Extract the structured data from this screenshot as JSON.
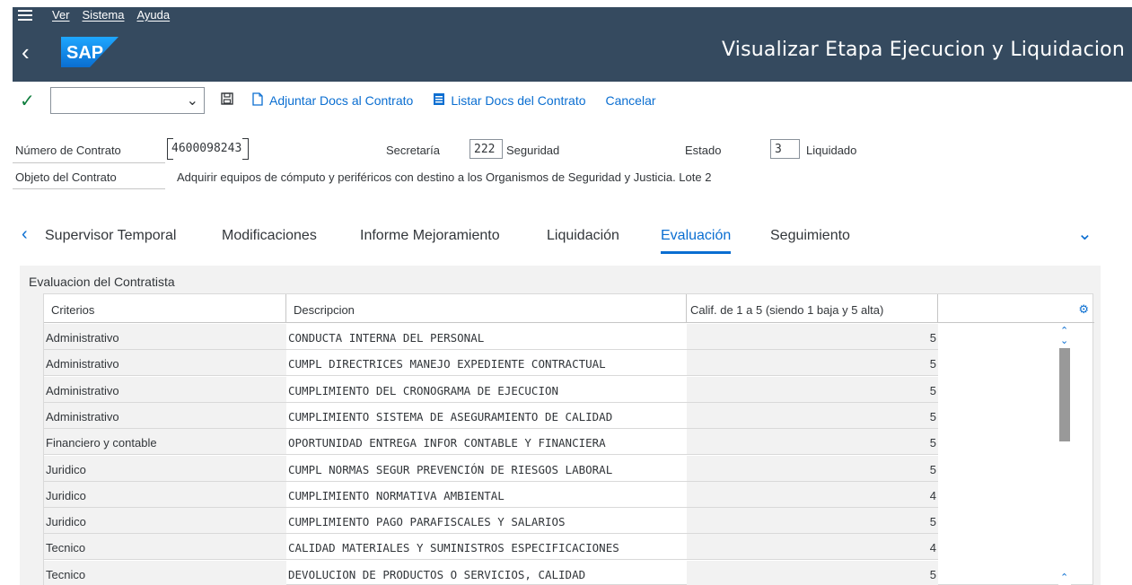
{
  "menu": {
    "items": [
      "Ver",
      "Sistema",
      "Ayuda"
    ]
  },
  "header": {
    "title": "Visualizar Etapa Ejecucion y Liquidacion",
    "logo_text": "SAP"
  },
  "toolbar": {
    "command_value": "",
    "attach_label": "Adjuntar Docs al Contrato",
    "list_label": "Listar Docs del Contrato",
    "cancel_label": "Cancelar"
  },
  "fields": {
    "contract_label": "Número de Contrato",
    "contract_value": "4600098243",
    "secretaria_label": "Secretaría",
    "secretaria_code": "222",
    "secretaria_name": "Seguridad",
    "estado_label": "Estado",
    "estado_code": "3",
    "estado_name": "Liquidado",
    "objeto_label": "Objeto del Contrato",
    "objeto_value": "Adquirir equipos de cómputo y periféricos con destino a los Organismos de Seguridad y Justicia. Lote 2"
  },
  "tabs": [
    "Supervisor Temporal",
    "Modificaciones",
    "Informe Mejoramiento",
    "Liquidación",
    "Evaluación",
    "Seguimiento"
  ],
  "active_tab": "Evaluación",
  "panel": {
    "title": "Evaluacion del Contratista",
    "columns": [
      "Criterios",
      "Descripcion",
      "Calif. de 1 a 5 (siendo 1 baja y 5 alta)"
    ],
    "rows": [
      {
        "criterio": "Administrativo",
        "descripcion": "CONDUCTA INTERNA DEL PERSONAL",
        "calif": "5"
      },
      {
        "criterio": "Administrativo",
        "descripcion": "CUMPL DIRECTRICES MANEJO EXPEDIENTE CONTRACTUAL",
        "calif": "5"
      },
      {
        "criterio": "Administrativo",
        "descripcion": "CUMPLIMIENTO DEL CRONOGRAMA DE EJECUCION",
        "calif": "5"
      },
      {
        "criterio": "Administrativo",
        "descripcion": "CUMPLIMIENTO SISTEMA DE ASEGURAMIENTO DE CALIDAD",
        "calif": "5"
      },
      {
        "criterio": "Financiero y contable",
        "descripcion": "OPORTUNIDAD ENTREGA INFOR CONTABLE Y FINANCIERA",
        "calif": "5"
      },
      {
        "criterio": "Juridico",
        "descripcion": "CUMPL NORMAS SEGUR PREVENCIÓN DE RIESGOS LABORAL",
        "calif": "5"
      },
      {
        "criterio": "Juridico",
        "descripcion": "CUMPLIMIENTO NORMATIVA AMBIENTAL",
        "calif": "4"
      },
      {
        "criterio": "Juridico",
        "descripcion": "CUMPLIMIENTO PAGO PARAFISCALES Y SALARIOS",
        "calif": "5"
      },
      {
        "criterio": "Tecnico",
        "descripcion": "CALIDAD MATERIALES Y SUMINISTROS ESPECIFICACIONES",
        "calif": "4"
      },
      {
        "criterio": "Tecnico",
        "descripcion": "DEVOLUCION DE PRODUCTOS O SERVICIOS, CALIDAD",
        "calif": "5"
      }
    ]
  },
  "colors": {
    "shell": "#354a5f",
    "accent": "#0a6ed1",
    "ok": "#107e3e"
  },
  "icons": [
    "menu-icon",
    "back-icon",
    "check-icon",
    "dropdown-chevron-icon",
    "save-icon",
    "attach-icon",
    "list-icon",
    "tab-prev-icon",
    "tab-more-icon",
    "settings-icon"
  ]
}
